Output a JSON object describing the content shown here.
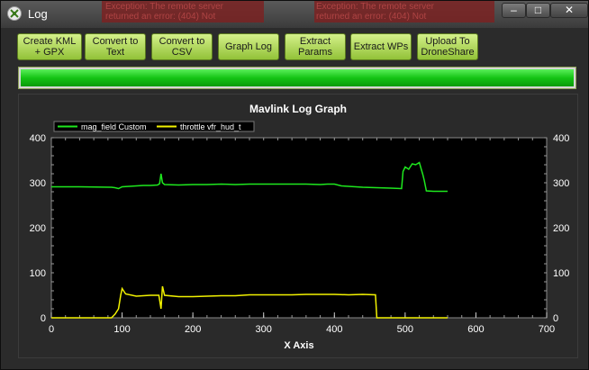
{
  "window": {
    "title": "Log",
    "controls": {
      "minimize": "–",
      "maximize": "□",
      "close": "✕"
    },
    "background_text": [
      "Exception: The remote server",
      "Exception: The remote server",
      "Exception: The remote server",
      "returned an error: (404) Not",
      "returned an error: (404) Not",
      "returned an error: (404) Not"
    ]
  },
  "toolbar": {
    "buttons": [
      {
        "label": "Create KML\n+ GPX"
      },
      {
        "label": "Convert to\nText"
      },
      {
        "label": "Convert to\nCSV"
      },
      {
        "label": "Graph Log"
      },
      {
        "label": "Extract\nParams"
      },
      {
        "label": "Extract WPs"
      },
      {
        "label": "Upload To\nDroneShare"
      }
    ]
  },
  "progress": {
    "value": 1.0
  },
  "graph": {
    "title": "Mavlink Log Graph"
  },
  "colors": {
    "accent": "#9fd243",
    "series1": "#1ee81e",
    "series2": "#f2f200",
    "plot_bg": "#000000"
  },
  "chart_data": {
    "type": "line",
    "title": "Mavlink Log Graph",
    "xlabel": "X Axis",
    "ylabel": "",
    "xlim": [
      0,
      700
    ],
    "ylim": [
      0,
      400
    ],
    "x_ticks": [
      "0",
      "100",
      "200",
      "300",
      "400",
      "500",
      "600",
      "700"
    ],
    "y_ticks": [
      "0",
      "100",
      "200",
      "300",
      "400"
    ],
    "y2_ticks": [
      "0",
      "100",
      "200",
      "300",
      "400"
    ],
    "legend": "top-left",
    "grid": false,
    "series": [
      {
        "name": "mag_field Custom",
        "color": "#1ee81e",
        "points": [
          [
            0,
            291
          ],
          [
            40,
            291
          ],
          [
            85,
            290
          ],
          [
            90,
            289
          ],
          [
            95,
            287
          ],
          [
            100,
            291
          ],
          [
            110,
            292
          ],
          [
            120,
            293
          ],
          [
            130,
            294
          ],
          [
            140,
            294
          ],
          [
            150,
            295
          ],
          [
            153,
            298
          ],
          [
            155,
            320
          ],
          [
            157,
            300
          ],
          [
            160,
            296
          ],
          [
            180,
            295
          ],
          [
            200,
            296
          ],
          [
            220,
            296
          ],
          [
            240,
            297
          ],
          [
            260,
            296
          ],
          [
            280,
            297
          ],
          [
            300,
            297
          ],
          [
            320,
            297
          ],
          [
            340,
            297
          ],
          [
            360,
            297
          ],
          [
            380,
            296
          ],
          [
            390,
            297
          ],
          [
            400,
            297
          ],
          [
            410,
            293
          ],
          [
            420,
            292
          ],
          [
            430,
            291
          ],
          [
            440,
            290
          ],
          [
            460,
            289
          ],
          [
            480,
            288
          ],
          [
            495,
            287
          ],
          [
            497,
            325
          ],
          [
            500,
            335
          ],
          [
            505,
            330
          ],
          [
            510,
            342
          ],
          [
            515,
            340
          ],
          [
            520,
            345
          ],
          [
            525,
            318
          ],
          [
            527,
            305
          ],
          [
            530,
            282
          ],
          [
            540,
            281
          ],
          [
            560,
            281
          ]
        ]
      },
      {
        "name": "throttle vfr_hud_t",
        "color": "#f2f200",
        "points": [
          [
            0,
            0
          ],
          [
            85,
            0
          ],
          [
            90,
            8
          ],
          [
            95,
            20
          ],
          [
            98,
            50
          ],
          [
            100,
            65
          ],
          [
            105,
            53
          ],
          [
            120,
            48
          ],
          [
            140,
            50
          ],
          [
            152,
            50
          ],
          [
            155,
            20
          ],
          [
            157,
            70
          ],
          [
            160,
            50
          ],
          [
            180,
            47
          ],
          [
            200,
            47
          ],
          [
            220,
            48
          ],
          [
            240,
            49
          ],
          [
            260,
            49
          ],
          [
            280,
            51
          ],
          [
            300,
            51
          ],
          [
            320,
            51
          ],
          [
            340,
            51
          ],
          [
            360,
            52
          ],
          [
            380,
            52
          ],
          [
            400,
            52
          ],
          [
            420,
            51
          ],
          [
            440,
            52
          ],
          [
            458,
            51
          ],
          [
            460,
            0
          ],
          [
            560,
            0
          ]
        ]
      }
    ]
  }
}
